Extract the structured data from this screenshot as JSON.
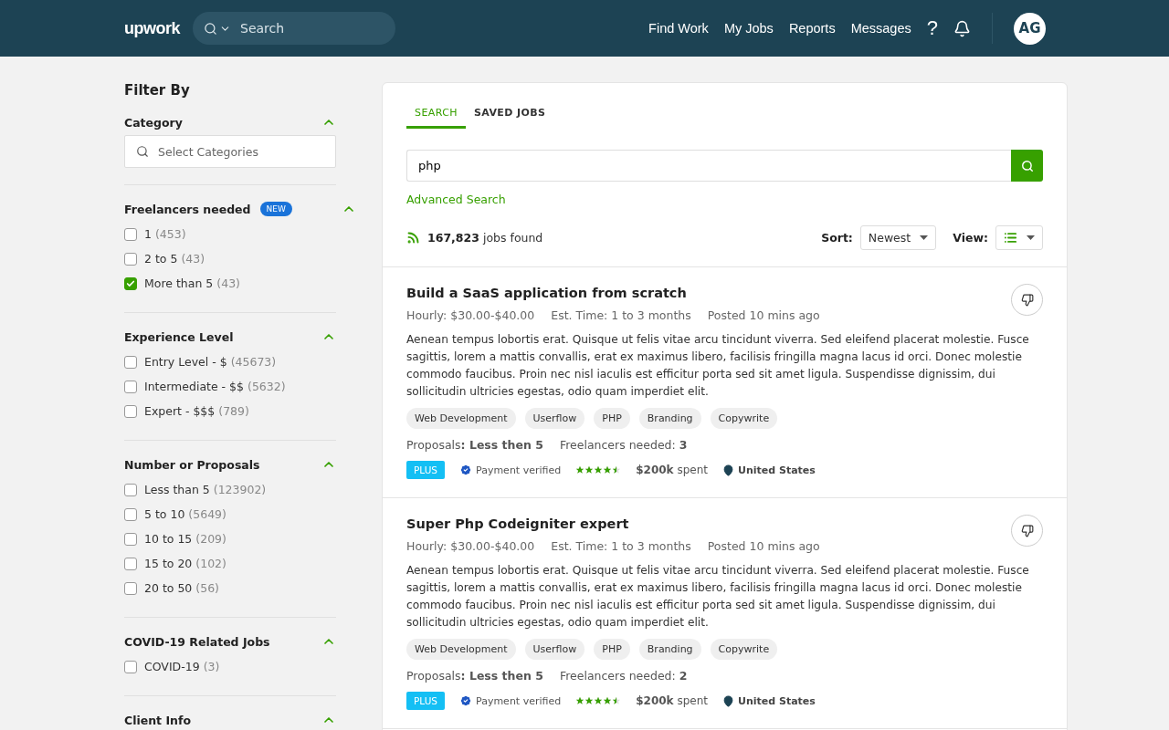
{
  "header": {
    "logo": "upwork",
    "search": {
      "placeholder": "Search"
    },
    "nav": [
      "Find Work",
      "My Jobs",
      "Reports",
      "Messages"
    ],
    "help": "?",
    "avatar": "AG"
  },
  "filters": {
    "title": "Filter By",
    "sections": [
      {
        "title": "Category",
        "expanded": true,
        "field": {
          "placeholder": "Select Categories"
        }
      },
      {
        "title": "Freelancers needed",
        "badge": "NEW",
        "expanded": true,
        "options": [
          {
            "label": "1",
            "count": "(453)",
            "checked": false
          },
          {
            "label": "2 to 5",
            "count": "(43)",
            "checked": false
          },
          {
            "label": "More than 5",
            "count": "(43)",
            "checked": true
          }
        ]
      },
      {
        "title": "Experience Level",
        "expanded": true,
        "options": [
          {
            "label": "Entry Level - $",
            "count": "(45673)",
            "checked": false
          },
          {
            "label": "Intermediate - $$",
            "count": "(5632)",
            "checked": false
          },
          {
            "label": "Expert - $$$",
            "count": "(789)",
            "checked": false
          }
        ]
      },
      {
        "title": "Number or Proposals",
        "expanded": true,
        "options": [
          {
            "label": "Less than 5",
            "count": "(123902)",
            "checked": false
          },
          {
            "label": "5 to 10",
            "count": "(5649)",
            "checked": false
          },
          {
            "label": "10 to 15",
            "count": "(209)",
            "checked": false
          },
          {
            "label": "15 to 20",
            "count": "(102)",
            "checked": false
          },
          {
            "label": "20 to 50",
            "count": "(56)",
            "checked": false
          }
        ]
      },
      {
        "title": "COVID-19 Related Jobs",
        "expanded": true,
        "options": [
          {
            "label": "COVID-19",
            "count": "(3)",
            "checked": false
          }
        ]
      },
      {
        "title": "Client Info",
        "expanded": true
      }
    ]
  },
  "tabs": [
    {
      "label": "SEARCH",
      "selected": true
    },
    {
      "label": "SAVED JOBS",
      "selected": false
    }
  ],
  "query": {
    "value": "php"
  },
  "advanced_search": "Advanced Search",
  "results": {
    "count": "167,823",
    "label": "jobs found",
    "sort_label": "Sort:",
    "sort": "Newest",
    "view_label": "View:"
  },
  "jobs": [
    {
      "title": "Build a SaaS application from scratch",
      "rate": "Hourly: $30.00-$40.00",
      "time": "Est. Time: 1 to 3 months",
      "posted": "Posted 10 mins ago",
      "description": "Aenean tempus lobortis erat. Quisque ut felis vitae arcu tincidunt viverra. Sed eleifend placerat molestie. Fusce sagittis, lorem a mattis convallis, erat ex maximus libero, facilisis fringilla magna lacus id orci. Donec molestie commodo faucibus. Proin nec nisl iaculis est efficitur porta sed sit amet ligula. Suspendisse dignissim, dui sollicitudin ultricies egestas, odio quam imperdiet elit.",
      "tags": [
        "Web Development",
        "Userflow",
        "PHP",
        "Branding",
        "Copywrite"
      ],
      "proposals": "Proposals**: Less then 5**",
      "freelancers": "Freelancers needed: **3**",
      "plus": "PLUS",
      "payment": "Payment verified",
      "stars": 4.5,
      "spent": "**$200k** spent",
      "location": "United States"
    },
    {
      "title": "Super Php Codeigniter expert",
      "rate": "Hourly: $30.00-$40.00",
      "time": "Est. Time: 1 to 3 months",
      "posted": "Posted 10 mins ago",
      "description": "Aenean tempus lobortis erat. Quisque ut felis vitae arcu tincidunt viverra. Sed eleifend placerat molestie. Fusce sagittis, lorem a mattis convallis, erat ex maximus libero, facilisis fringilla magna lacus id orci. Donec molestie commodo faucibus. Proin nec nisl iaculis est efficitur porta sed sit amet ligula. Suspendisse dignissim, dui sollicitudin ultricies egestas, odio quam imperdiet elit.",
      "tags": [
        "Web Development",
        "Userflow",
        "PHP",
        "Branding",
        "Copywrite"
      ],
      "proposals": "Proposals**: Less then 5**",
      "freelancers": "Freelancers needed: **2**",
      "plus": "PLUS",
      "payment": "Payment verified",
      "stars": 4.5,
      "spent": "**$200k** spent",
      "location": "United States"
    }
  ]
}
